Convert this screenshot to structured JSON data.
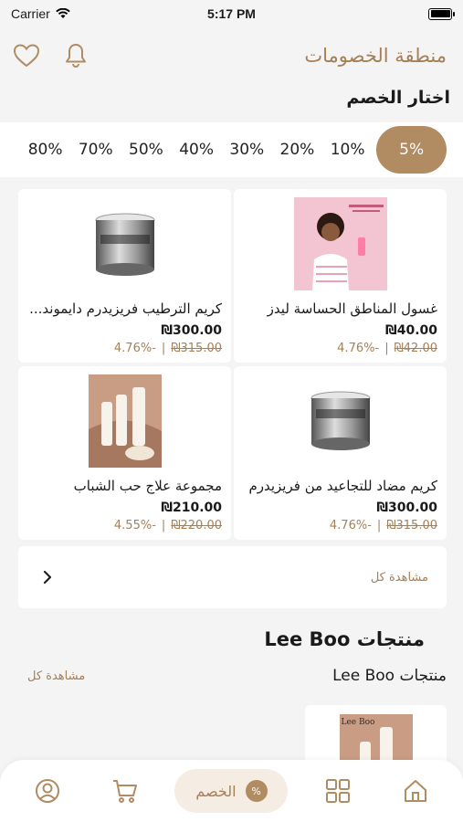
{
  "status_bar": {
    "carrier": "Carrier",
    "time": "5:17 PM"
  },
  "header": {
    "title": "منطقة الخصومات",
    "icons": [
      "bell-icon",
      "heart-icon"
    ]
  },
  "discount_section": {
    "label": "اختار الخصم",
    "options": [
      "5%",
      "10%",
      "20%",
      "30%",
      "40%",
      "50%",
      "70%",
      "80%"
    ],
    "selected": "5%"
  },
  "products": [
    {
      "name": "غسول المناطق الحساسة ليدز",
      "price": "₪40.00",
      "old_price": "₪42.00",
      "discount": "-4.76%"
    },
    {
      "name": "كريم الترطيب فريزيدرم دايموند...",
      "price": "₪300.00",
      "old_price": "₪315.00",
      "discount": "-4.76%"
    },
    {
      "name": "كريم مضاد للتجاعيد من فريزيدرم",
      "price": "₪300.00",
      "old_price": "₪315.00",
      "discount": "-4.76%"
    },
    {
      "name": "مجموعة علاج حب الشباب",
      "price": "₪210.00",
      "old_price": "₪220.00",
      "discount": "-4.55%"
    }
  ],
  "view_all": {
    "label": "مشاهدة كل"
  },
  "brand_section": {
    "title": "منتجات Lee Boo",
    "subtitle": "منتجات Lee Boo",
    "view_all": "مشاهدة كل",
    "product_brand_text": "Lee Boo"
  },
  "tabbar": {
    "active_label": "الخصم",
    "badge": "%",
    "icons": [
      "home-icon",
      "grid-icon",
      "cart-icon",
      "profile-icon"
    ]
  },
  "colors": {
    "accent": "#b18b62",
    "accent_text": "#a57f56"
  }
}
